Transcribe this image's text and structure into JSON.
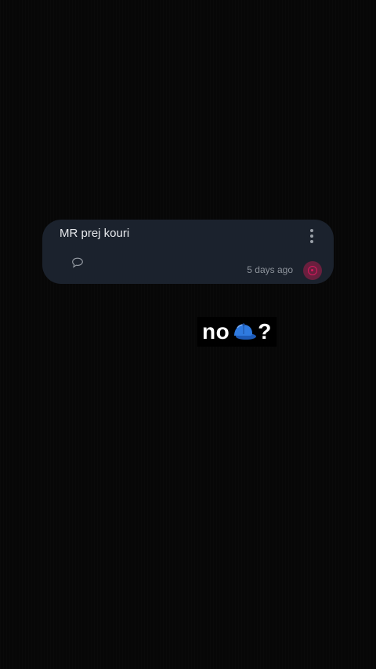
{
  "card": {
    "title": "MR prej kouri",
    "time": "5 days ago",
    "icons": {
      "more": "more-vertical-icon",
      "comment": "comment-icon",
      "avatar": "avatar-icon"
    },
    "colors": {
      "background": "#1b222d",
      "avatar": "#6a1f3e",
      "avatar_accent": "#d81b60"
    }
  },
  "sticker": {
    "prefix": "no",
    "emoji": "blue-cap-icon",
    "suffix": "?"
  }
}
